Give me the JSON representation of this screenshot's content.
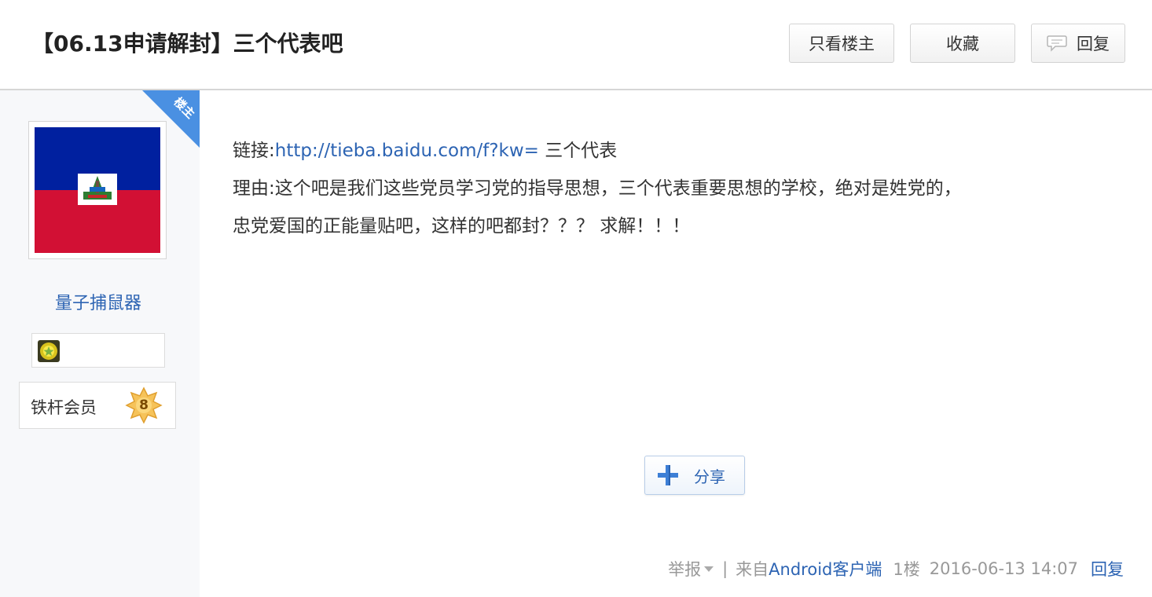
{
  "thread": {
    "title": "【06.13申请解封】三个代表吧"
  },
  "header_buttons": {
    "only_op": "只看楼主",
    "favorite": "收藏",
    "reply": "回复"
  },
  "author": {
    "op_corner_label": "楼主",
    "username": "量子捕鼠器",
    "level_title": "铁杆会员",
    "level_number": "8"
  },
  "post": {
    "link_prefix": "链接:",
    "link_url": "http://tieba.baidu.com/f?kw=",
    "link_suffix": " 三个代表",
    "line2": "理由:这个吧是我们这些党员学习党的指导思想，三个代表重要思想的学校，绝对是姓党的，",
    "line3": "忠党爱国的正能量贴吧，这样的吧都封？？？ 求解！！！",
    "share_label": "分享"
  },
  "tail": {
    "report": "举报",
    "separator": "|",
    "from_prefix": "来自",
    "client": "Android客户端",
    "floor": "1楼",
    "time": "2016-06-13 14:07",
    "reply": "回复"
  },
  "colors": {
    "link_blue": "#2d64b3",
    "corner_blue": "#4a90e2",
    "sidebar_bg": "#f7f8fa",
    "flag_blue": "#00209f",
    "flag_red": "#d21034"
  },
  "icons": {
    "reply": "speech-bubble-icon",
    "report_dropdown": "triangle-down-icon",
    "share": "plus-icon",
    "badge": "medal-icon",
    "level": "star-badge-icon"
  }
}
